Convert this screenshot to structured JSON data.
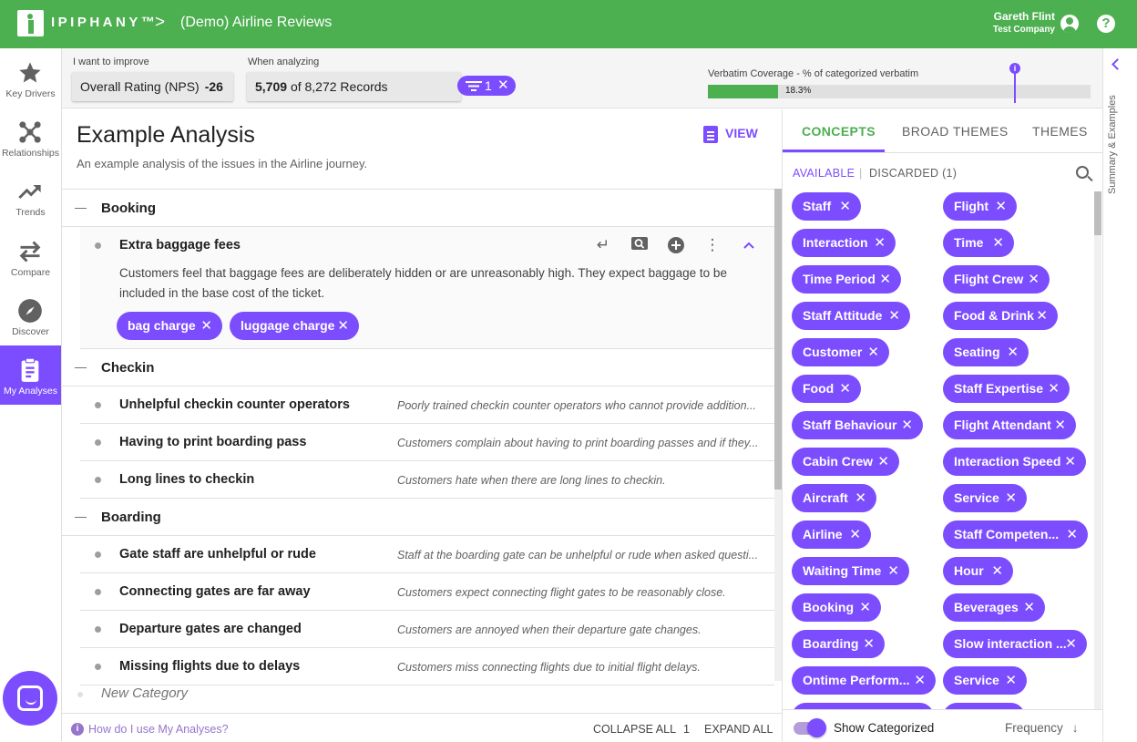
{
  "topbar": {
    "logo": "IPIPHANY™",
    "breadcrumb_sep": ">",
    "title": "(Demo) Airline Reviews",
    "user_name": "Gareth Flint",
    "user_company": "Test Company",
    "help": "?"
  },
  "nav": [
    {
      "label": "Key Drivers",
      "icon": "star-icon"
    },
    {
      "label": "Relationships",
      "icon": "network-icon"
    },
    {
      "label": "Trends",
      "icon": "trend-icon"
    },
    {
      "label": "Compare",
      "icon": "swap-icon"
    },
    {
      "label": "Discover",
      "icon": "compass-icon"
    },
    {
      "label": "My Analyses",
      "icon": "clipboard-icon"
    }
  ],
  "filters": {
    "improve_label": "I want to improve",
    "improve_value": "Overall Rating (NPS)",
    "nps": "-26",
    "analyzing_label": "When analyzing",
    "records_count": "5,709",
    "records_text": "of 8,272 Records",
    "filter_count": "1",
    "coverage_label": "Verbatim Coverage - % of categorized verbatim",
    "coverage_value": "18.3%",
    "coverage_fraction": 0.183
  },
  "analysis": {
    "title": "Example Analysis",
    "subtitle": "An example analysis of the issues in the Airline journey.",
    "view_label": "VIEW",
    "expanded_desc": "Customers feel that baggage fees are deliberately hidden or are unreasonably high. They expect baggage to be included in the base cost of the ticket.",
    "expanded_tags": [
      "bag charge",
      "luggage charge"
    ],
    "categories": [
      {
        "name": "Booking",
        "items": [
          {
            "name": "Extra baggage fees",
            "desc": ""
          }
        ]
      },
      {
        "name": "Checkin",
        "items": [
          {
            "name": "Unhelpful checkin counter operators",
            "desc": "Poorly trained checkin counter operators who cannot provide addition..."
          },
          {
            "name": "Having to print boarding pass",
            "desc": "Customers complain about having to print boarding passes and if they..."
          },
          {
            "name": "Long lines to checkin",
            "desc": "Customers hate when there are long lines to checkin."
          }
        ]
      },
      {
        "name": "Boarding",
        "items": [
          {
            "name": "Gate staff are unhelpful or rude",
            "desc": "Staff at the boarding gate can be unhelpful or rude when asked questi..."
          },
          {
            "name": "Connecting gates are far away",
            "desc": "Customers expect connecting flight gates to be reasonably close."
          },
          {
            "name": "Departure gates are changed",
            "desc": "Customers are annoyed when their departure gate changes."
          },
          {
            "name": "Missing flights due to delays",
            "desc": "Customers miss connecting flights due to initial flight delays."
          }
        ]
      }
    ],
    "new_category": "New Category",
    "help_link": "How do I use My Analyses?",
    "collapse_all": "COLLAPSE ALL",
    "level": "1",
    "expand_all": "EXPAND ALL"
  },
  "panel": {
    "tabs": [
      "CONCEPTS",
      "BROAD THEMES",
      "THEMES"
    ],
    "available": "AVAILABLE",
    "sep": "|",
    "discarded": "DISCARDED (1)",
    "concepts_left": [
      "Staff",
      "Interaction",
      "Time Period",
      "Staff Attitude",
      "Customer",
      "Food",
      "Staff Behaviour",
      "Cabin Crew",
      "Aircraft",
      "Airline",
      "Waiting Time",
      "Booking",
      "Boarding",
      "Ontime Perform..."
    ],
    "concepts_right": [
      "Flight",
      "Time",
      "Flight Crew",
      "Food & Drink",
      "Seating",
      "Staff Expertise",
      "Flight Attendant",
      "Interaction Speed",
      "Service",
      "Staff Competen...",
      "Hour",
      "Beverages",
      "Slow interaction ...",
      "Service"
    ],
    "show_categorized": "Show Categorized",
    "sort_label": "Frequency"
  },
  "rail": {
    "label": "Summary & Examples"
  },
  "colors": {
    "brand_green": "#4caf50",
    "accent_purple": "#7c4dff"
  }
}
